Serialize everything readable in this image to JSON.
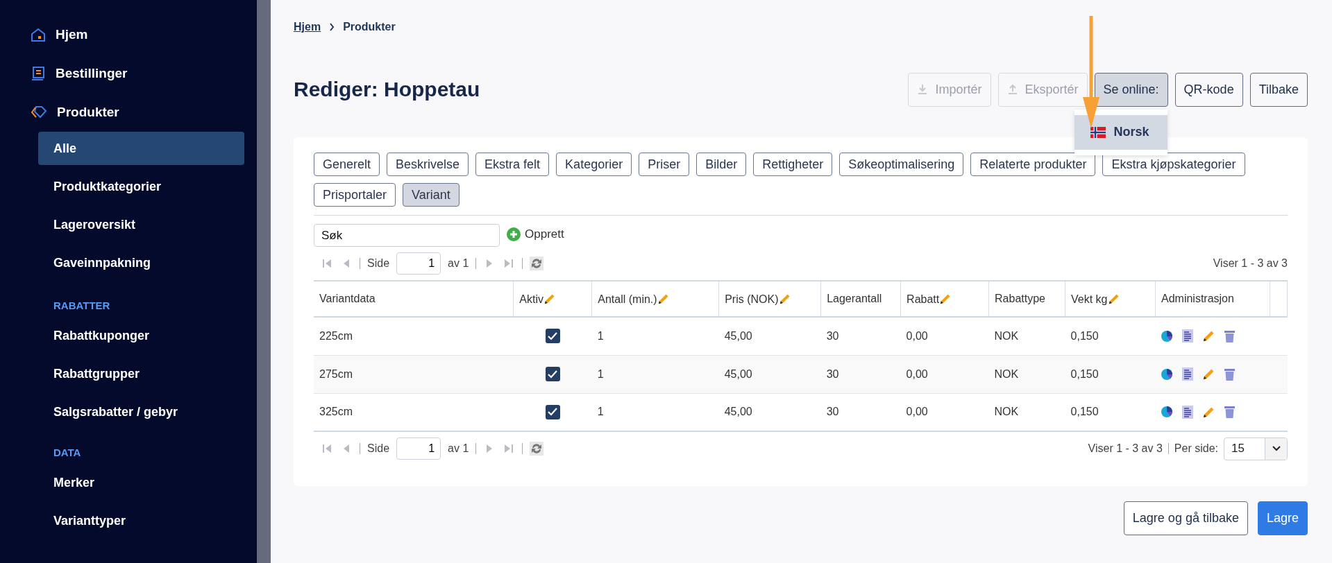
{
  "sidebar": {
    "sections": [
      {
        "items": [
          {
            "label": "Hjem",
            "selected": false
          },
          {
            "label": "Bestillinger",
            "selected": false
          },
          {
            "label": "Produkter",
            "selected": false,
            "children": [
              {
                "label": "Alle",
                "selected": true
              },
              {
                "label": "Produktkategorier",
                "selected": false
              },
              {
                "label": "Lageroversikt",
                "selected": false
              },
              {
                "label": "Gaveinnpakning",
                "selected": false
              }
            ]
          }
        ]
      },
      {
        "heading": "RABATTER",
        "items": [
          {
            "label": "Rabattkuponger",
            "selected": false
          },
          {
            "label": "Rabattgrupper",
            "selected": false
          },
          {
            "label": "Salgsrabatter / gebyr",
            "selected": false
          }
        ]
      },
      {
        "heading": "DATA",
        "items": [
          {
            "label": "Merker",
            "selected": false
          },
          {
            "label": "Varianttyper",
            "selected": false
          }
        ]
      }
    ]
  },
  "breadcrumb": [
    {
      "label": "Hjem",
      "kind": "link"
    },
    {
      "label": "Produkter",
      "kind": "current"
    }
  ],
  "title": "Rediger: Hoppetau",
  "actions": [
    {
      "label": "Importér",
      "kind": "import",
      "disabled": true,
      "active": false
    },
    {
      "label": "Eksportér",
      "kind": "export",
      "disabled": true,
      "active": false
    },
    {
      "label": "Se online:",
      "kind": "menu",
      "disabled": false,
      "active": true,
      "menu": [
        {
          "label": "Norsk",
          "selected": true
        }
      ]
    },
    {
      "label": "QR-kode",
      "kind": "plain",
      "disabled": false,
      "active": false
    },
    {
      "label": "Tilbake",
      "kind": "plain",
      "disabled": false,
      "active": false
    }
  ],
  "tabs": [
    {
      "label": "Generelt",
      "selected": false
    },
    {
      "label": "Beskrivelse",
      "selected": false
    },
    {
      "label": "Ekstra felt",
      "selected": false
    },
    {
      "label": "Kategorier",
      "selected": false
    },
    {
      "label": "Priser",
      "selected": false
    },
    {
      "label": "Bilder",
      "selected": false
    },
    {
      "label": "Rettigheter",
      "selected": false
    },
    {
      "label": "Søkeoptimalisering",
      "selected": false
    },
    {
      "label": "Relaterte produkter",
      "selected": false
    },
    {
      "label": "Ekstra kjøpskategorier",
      "selected": false
    },
    {
      "label": "Prisportaler",
      "selected": false
    },
    {
      "label": "Variant",
      "selected": true
    }
  ],
  "search": {
    "value": "Søk"
  },
  "create": "Opprett",
  "pager_top": {
    "side": "Side",
    "page": "1",
    "of": "av 1",
    "showing": "Viser 1 - 3 av 3"
  },
  "table": {
    "columns": [
      {
        "label": "Variantdata",
        "editable": false
      },
      {
        "label": "Aktiv",
        "editable": true
      },
      {
        "label": "Antall (min.)",
        "editable": true
      },
      {
        "label": "Pris (NOK)",
        "editable": true
      },
      {
        "label": "Lagerantall",
        "editable": false
      },
      {
        "label": "Rabatt",
        "editable": true
      },
      {
        "label": "Rabattype",
        "editable": false
      },
      {
        "label": "Vekt kg",
        "editable": true
      },
      {
        "label": "Administrasjon",
        "editable": false
      }
    ],
    "rows": [
      {
        "variant": "225cm",
        "active": true,
        "min": "1",
        "price": "45,00",
        "stock": "30",
        "discount": "0,00",
        "discount_type": "NOK",
        "weight": "0,150"
      },
      {
        "variant": "275cm",
        "active": true,
        "min": "1",
        "price": "45,00",
        "stock": "30",
        "discount": "0,00",
        "discount_type": "NOK",
        "weight": "0,150"
      },
      {
        "variant": "325cm",
        "active": true,
        "min": "1",
        "price": "45,00",
        "stock": "30",
        "discount": "0,00",
        "discount_type": "NOK",
        "weight": "0,150"
      }
    ]
  },
  "pager_bottom": {
    "side": "Side",
    "page": "1",
    "of": "av 1",
    "showing": "Viser 1 - 3 av 3",
    "per_page_label": "Per side:",
    "per_page": "15"
  },
  "footer_buttons": [
    {
      "label": "Lagre og gå tilbake",
      "kind": "secondary"
    },
    {
      "label": "Lagre",
      "kind": "primary"
    }
  ]
}
